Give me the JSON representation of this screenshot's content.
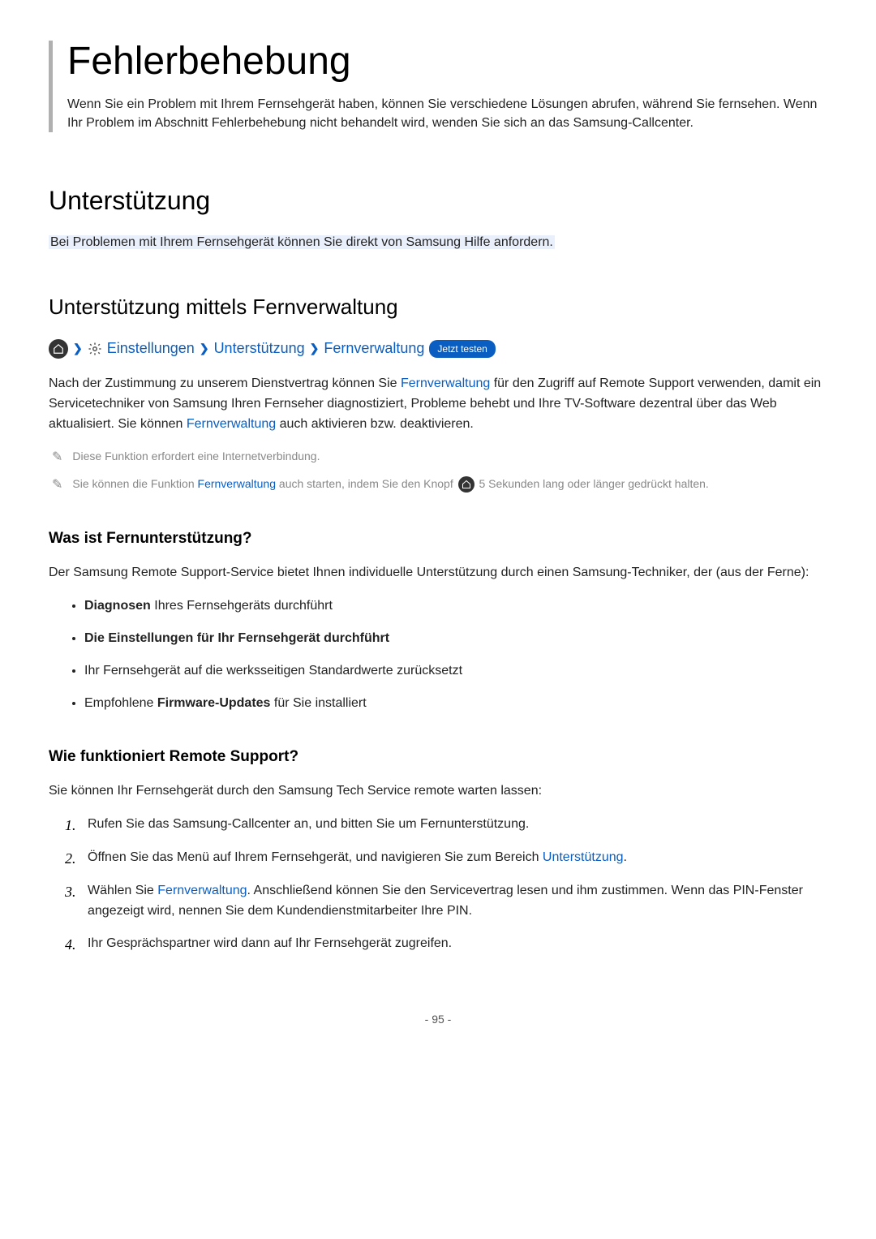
{
  "title": "Fehlerbehebung",
  "intro": "Wenn Sie ein Problem mit Ihrem Fernsehgerät haben, können Sie verschiedene Lösungen abrufen, während Sie fernsehen. Wenn Ihr Problem im Abschnitt Fehlerbehebung nicht behandelt wird, wenden Sie sich an das Samsung-Callcenter.",
  "h2": "Unterstützung",
  "h2_highlight": "Bei Problemen mit Ihrem Fernsehgerät können Sie direkt von Samsung Hilfe anfordern.",
  "h3": "Unterstützung mittels Fernverwaltung",
  "nav": {
    "settings": "Einstellungen",
    "support": "Unterstützung",
    "remote": "Fernverwaltung",
    "badge": "Jetzt testen"
  },
  "para_main": {
    "p1a": "Nach der Zustimmung zu unserem Dienstvertrag können Sie ",
    "p1_link1": "Fernverwaltung",
    "p1b": " für den Zugriff auf Remote Support verwenden, damit ein Servicetechniker von Samsung Ihren Fernseher diagnostiziert, Probleme behebt und Ihre TV-Software dezentral über das Web aktualisiert. Sie können ",
    "p1_link2": "Fernverwaltung",
    "p1c": " auch aktivieren bzw. deaktivieren."
  },
  "note1": "Diese Funktion erfordert eine Internetverbindung.",
  "note2": {
    "a": "Sie können die Funktion ",
    "link": "Fernverwaltung",
    "b": " auch starten, indem Sie den Knopf ",
    "c": " 5 Sekunden lang oder länger gedrückt halten."
  },
  "h4a": "Was ist Fernunterstützung?",
  "para_h4a": "Der Samsung Remote Support-Service bietet Ihnen individuelle Unterstützung durch einen Samsung-Techniker, der (aus der Ferne):",
  "bullets": {
    "b1_bold": "Diagnosen",
    "b1_rest": " Ihres Fernsehgeräts durchführt",
    "b2": "Die Einstellungen für Ihr Fernsehgerät durchführt",
    "b3": "Ihr Fernsehgerät auf die werksseitigen Standardwerte zurücksetzt",
    "b4_a": "Empfohlene ",
    "b4_bold": "Firmware-Updates",
    "b4_b": " für Sie installiert"
  },
  "h4b": "Wie funktioniert Remote Support?",
  "para_h4b": "Sie können Ihr Fernsehgerät durch den Samsung Tech Service remote warten lassen:",
  "steps": {
    "s1": "Rufen Sie das Samsung-Callcenter an, und bitten Sie um Fernunterstützung.",
    "s2a": "Öffnen Sie das Menü auf Ihrem Fernsehgerät, und navigieren Sie zum Bereich ",
    "s2_link": "Unterstützung",
    "s2b": ".",
    "s3a": "Wählen Sie ",
    "s3_link": "Fernverwaltung",
    "s3b": ". Anschließend können Sie den Servicevertrag lesen und ihm zustimmen. Wenn das PIN-Fenster angezeigt wird, nennen Sie dem Kundendienstmitarbeiter Ihre PIN.",
    "s4": "Ihr Gesprächspartner wird dann auf Ihr Fernsehgerät zugreifen."
  },
  "page_num": "- 95 -"
}
